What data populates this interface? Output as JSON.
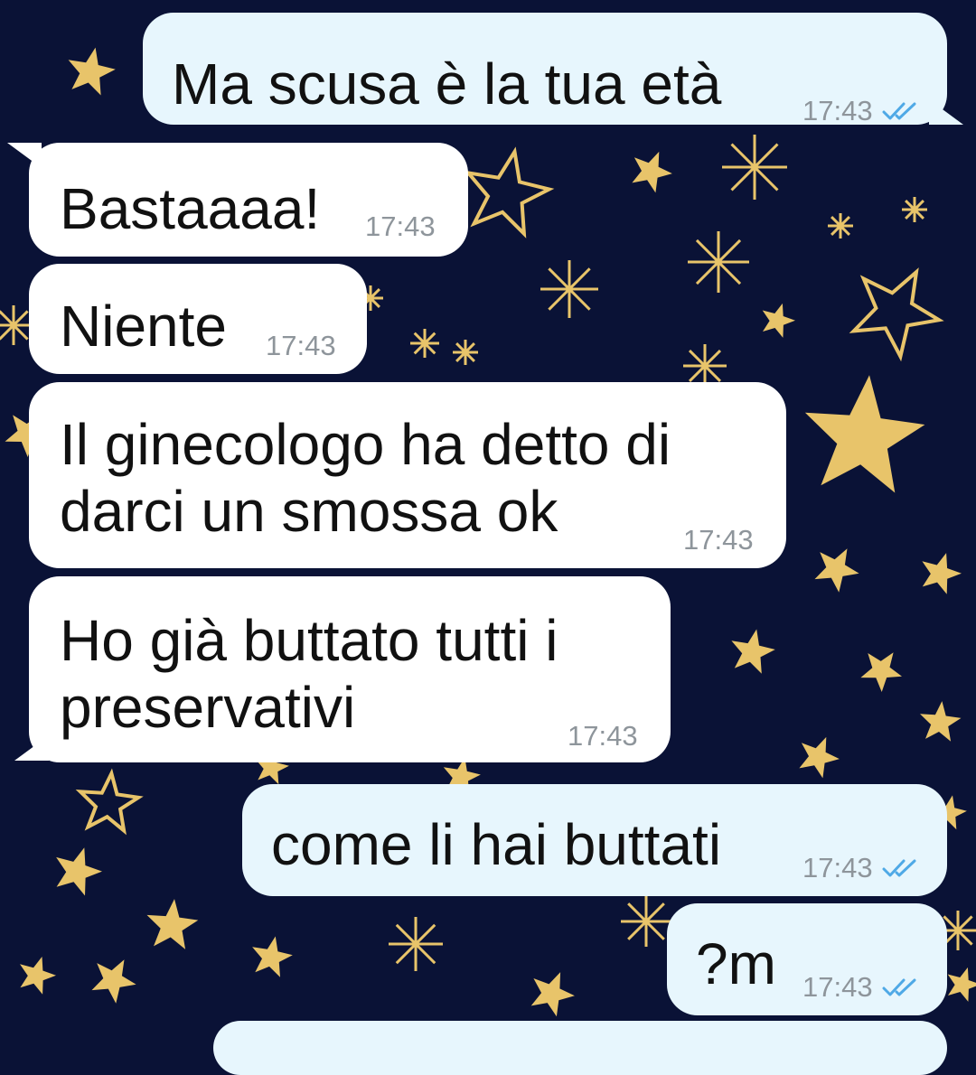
{
  "chat": {
    "messages": [
      {
        "direction": "outgoing",
        "text": "Ma scusa è la tua età",
        "time": "17:43",
        "status": "read-double-check-icon"
      },
      {
        "direction": "incoming",
        "text": "Bastaaaa!",
        "time": "17:43"
      },
      {
        "direction": "incoming",
        "text": "Niente",
        "time": "17:43"
      },
      {
        "direction": "incoming",
        "text": "Il ginecologo ha detto di\ndarci un smossa ok",
        "time": "17:43"
      },
      {
        "direction": "incoming",
        "text": "Ho già buttato tutti i\npreservativi",
        "time": "17:43"
      },
      {
        "direction": "outgoing",
        "text": "come li hai buttati",
        "time": "17:43",
        "status": "read-double-check-icon"
      },
      {
        "direction": "outgoing",
        "text": "?m",
        "time": "17:43",
        "status": "read-double-check-icon"
      }
    ]
  },
  "theme": {
    "wallpaper": "#0a1236",
    "star_color": "#e8c46a",
    "incoming_bubble": "#ffffff",
    "outgoing_bubble": "#e7f6fd",
    "tick_color": "#4fa9e6",
    "time_color": "#8e959b"
  }
}
